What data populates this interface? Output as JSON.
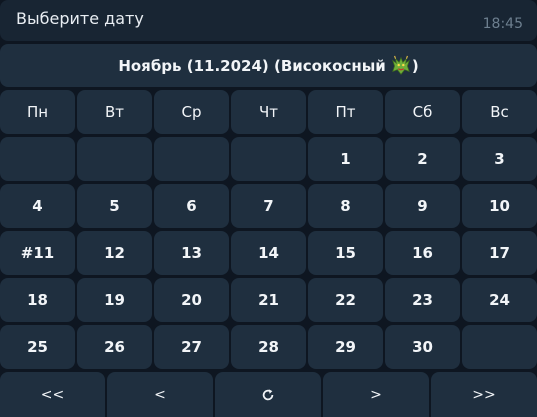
{
  "message": {
    "text": "Выберите дату",
    "time": "18:45"
  },
  "calendar": {
    "header_prefix": "Ноябрь (11.2024) (Високосный",
    "header_suffix": ")",
    "header_icon": "dragon-icon",
    "weekdays": [
      "Пн",
      "Вт",
      "Ср",
      "Чт",
      "Пт",
      "Сб",
      "Вс"
    ],
    "weeks": [
      [
        "",
        "",
        "",
        "",
        "1",
        "2",
        "3"
      ],
      [
        "4",
        "5",
        "6",
        "7",
        "8",
        "9",
        "10"
      ],
      [
        "#11",
        "12",
        "13",
        "14",
        "15",
        "16",
        "17"
      ],
      [
        "18",
        "19",
        "20",
        "21",
        "22",
        "23",
        "24"
      ],
      [
        "25",
        "26",
        "27",
        "28",
        "29",
        "30",
        ""
      ]
    ],
    "nav": {
      "first": "<<",
      "prev": "<",
      "refresh_icon": "refresh-icon",
      "next": ">",
      "last": ">>"
    }
  },
  "colors": {
    "background": "#0e1621",
    "message_bg": "#182533",
    "button_bg": "#1f2f3f",
    "button_text": "#f2f5f8",
    "time_text": "#6d7f8f"
  }
}
